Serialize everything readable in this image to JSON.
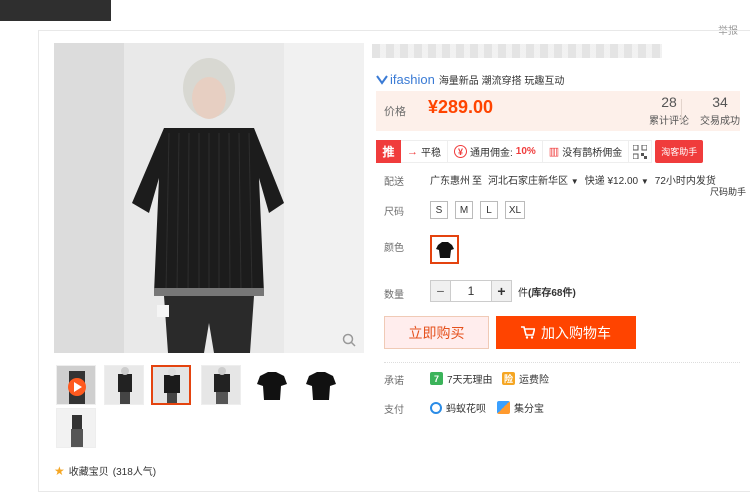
{
  "report_link": "举报",
  "brand": {
    "name": "ifashion",
    "tags": "海量新品 潮流穿搭 玩趣互动"
  },
  "price": {
    "label": "价格",
    "value": "¥289.00"
  },
  "stats": [
    {
      "number": "28",
      "label": "累计评论"
    },
    {
      "number": "34",
      "label": "交易成功"
    }
  ],
  "promo": {
    "badge": "推",
    "items": [
      {
        "label": "平稳",
        "icon": "trend-icon"
      },
      {
        "label": "通用佣金:",
        "highlight": "10%",
        "icon": "commission-icon"
      },
      {
        "label": "没有鹊桥佣金",
        "icon": "chart-icon"
      }
    ],
    "helper": "淘客助手"
  },
  "size_helper": "尺码助手",
  "shipping": {
    "label": "配送",
    "from": "广东惠州",
    "to_word": "至",
    "to": "河北石家庄新华区",
    "express": "快递 ¥12.00",
    "eta": "72小时内发货"
  },
  "size_section": {
    "label": "尺码",
    "options": [
      "S",
      "M",
      "L",
      "XL"
    ]
  },
  "color_section": {
    "label": "颜色",
    "selected": "black-tshirt"
  },
  "quantity": {
    "label": "数量",
    "value": "1",
    "unit": "件",
    "stock": "(库存68件)"
  },
  "buttons": {
    "buy_now": "立即购买",
    "add_cart": "加入购物车"
  },
  "promise": {
    "label": "承诺",
    "items": [
      "7天无理由",
      "运费险"
    ]
  },
  "payment": {
    "label": "支付",
    "items": [
      "蚂蚁花呗",
      "集分宝"
    ]
  },
  "favorite": {
    "label": "收藏宝贝",
    "count": "(318人气)"
  },
  "colors": {
    "accent": "#ff4400",
    "price": "#ff4400",
    "promo_red": "#f03c3c",
    "brand_blue": "#3a7bd5"
  }
}
